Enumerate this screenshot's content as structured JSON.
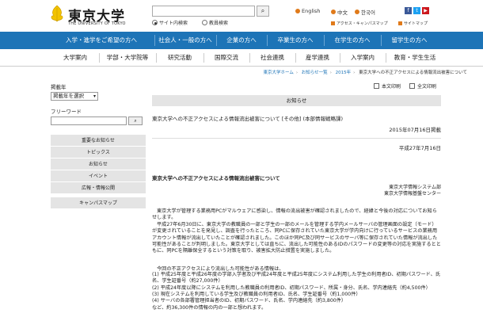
{
  "header": {
    "logo_jp": "東京大学",
    "logo_en": "THE UNIVERSITY OF TOKYO",
    "search_placeholder": "",
    "search_button_icon": "search-icon",
    "radio_site": "サイト内検索",
    "radio_faculty": "教員検索",
    "lang_english": "English",
    "lang_chinese": "中文",
    "lang_korean": "한국어",
    "access_map": "アクセス・キャンパスマップ",
    "sitemap": "サイトマップ",
    "social_icons": [
      "facebook-icon",
      "twitter-icon",
      "youtube-icon"
    ]
  },
  "audience_nav": [
    "入学・進学をご希望の方へ",
    "社会人・一般の方へ",
    "企業の方へ",
    "卒業生の方へ",
    "在学生の方へ",
    "留学生の方へ"
  ],
  "main_nav": [
    "大学案内",
    "学部・大学院等",
    "研究活動",
    "国際交流",
    "社会連携",
    "産学連携",
    "入学案内",
    "教育・学生生活"
  ],
  "breadcrumb": [
    "東京大学ホーム",
    "お知らせ一覧",
    "2015年",
    "東京大学への不正アクセスによる情報流出被害について"
  ],
  "sidebar": {
    "year_label": "掲載年",
    "year_select": "掲載年を選択",
    "freeword_label": "フリーワード",
    "go_button": "",
    "categories_top": [
      "重要なお知らせ",
      "トピックス",
      "お知らせ",
      "イベント",
      "広報・情報公開"
    ],
    "categories_bottom": [
      "キャンパスマップ"
    ]
  },
  "content": {
    "print_label": "本文印刷",
    "full_print_label": "全文印刷",
    "section_header": "お知らせ",
    "news_title": "東京大学への不正アクセスによる情報流出被害について [その他] (本部情報戦略課)",
    "posted_date": "2015年07月16日掲載",
    "doc_date": "平成27年7月16日",
    "doc_title": "東京大学への不正アクセスによる情報流出被害について",
    "sign_1": "東京大学情報システム部",
    "sign_2": "東京大学情報基盤センター",
    "para1": "東京大学が管理する業務用PCがマルウェアに感染し、情報の流出被害が確認されましたので、経緯と今後の対応についてお知らせします。",
    "para2": "平成27年6月30日に、東京大学の教職員の一部と学生の一部のメールを管理する学内メールサーバの管理画面の設定（モード）が変更されていることを発見し、調査を行ったところ、同PCに保存されていた東京大学が学内向けに行っているサービスの業務用アカウント情報が流出していたことが確認されました。このほか同PC及び同サービスのサーバ等に保存されていた情報が流出した可能性があることが判明しました。東京大学としては直ちに、流出した可能性のあるIDのパスワードの変更等の対応を実施するとともに、同PCを隔離保全するという対策を取り、被害拡大防止措置を実施しました。",
    "list_intro": "今回の不正アクセスにより流出した可能性がある情報は、",
    "list": [
      "(1) 平成25年度と平成26年度の学部入学者及び平成24年度と平成25年度にシステム利用した学生の利用者ID、初期パスワード、氏名、学生証番号（約27,000件）",
      "(2) 平成24年度以降にシステムを利用した教職員の利用者ID、初期パスワード、所属・身分、氏名、学内連絡先（約4,500件）",
      "(3) 現在システムを利用している学生及び教職員の利用者ID、氏名、学生証番号（約1,000件）",
      "(4) サーバの各部署管理担当者のID、初期パスワード、氏名、学内連絡先（約3,800件）",
      "など、約36,300件の情報の内の一部と想われます。"
    ]
  },
  "colors": {
    "brand_blue": "#1d74b7",
    "sidebar_gray": "#e4e4e4",
    "accent_orange": "#e07a1a"
  }
}
